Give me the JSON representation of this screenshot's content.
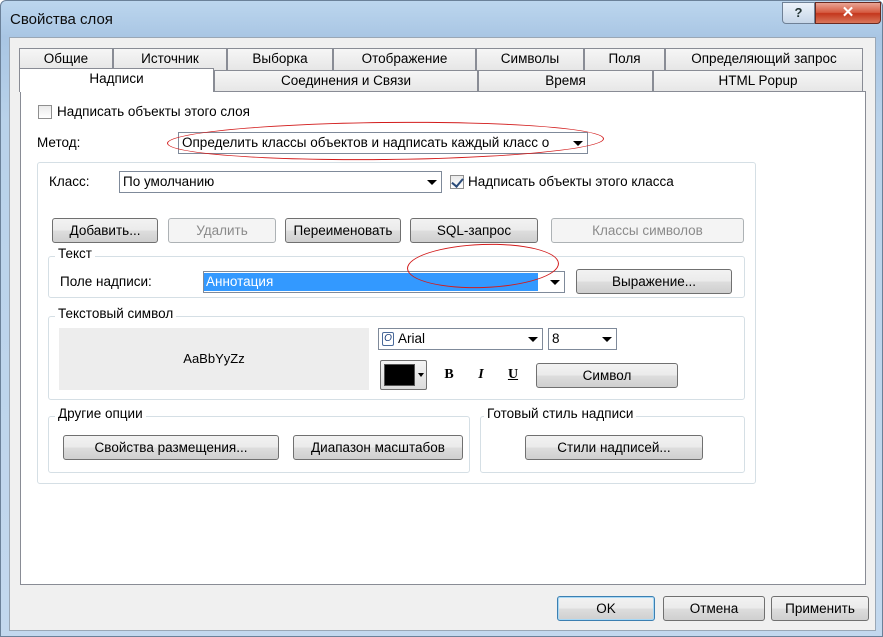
{
  "window": {
    "title": "Свойства слоя",
    "help_glyph": "?",
    "close_glyph": "✕"
  },
  "tabs_row1": [
    "Общие",
    "Источник",
    "Выборка",
    "Отображение",
    "Символы",
    "Поля",
    "Определяющий запрос"
  ],
  "tabs_row2": [
    "Надписи",
    "Соединения и Связи",
    "Время",
    "HTML Popup"
  ],
  "labels_tab": {
    "label_layer_checkbox": "Надписать объекты этого слоя",
    "method_label": "Метод:",
    "method_value": "Определить классы объектов и надписать каждый класс о",
    "class_label": "Класс:",
    "class_value": "По умолчанию",
    "label_class_checkbox": "Надписать объекты этого класса",
    "buttons": {
      "add": "Добавить...",
      "delete": "Удалить",
      "rename": "Переименовать",
      "sql": "SQL-запрос",
      "symbol_classes": "Классы символов"
    },
    "text_group": {
      "title": "Текст",
      "field_label": "Поле надписи:",
      "field_value": "Аннотация",
      "expression_button": "Выражение..."
    },
    "symbol_group": {
      "title": "Текстовый символ",
      "preview_text": "AaBbYyZz",
      "font_glyph": "O",
      "font_name": "Arial",
      "font_size": "8",
      "bold": "B",
      "italic": "I",
      "underline": "U",
      "symbol_button": "Символ",
      "color": "#000000"
    },
    "other_options": {
      "title": "Другие опции",
      "placement_button": "Свойства размещения...",
      "scale_button": "Диапазон масштабов"
    },
    "style_group": {
      "title": "Готовый стиль надписи",
      "styles_button": "Стили надписей..."
    }
  },
  "footer": {
    "ok": "OK",
    "cancel": "Отмена",
    "apply": "Применить"
  },
  "colors": {
    "annotation_red": "#d21c1c",
    "selection_blue": "#3399ff"
  }
}
